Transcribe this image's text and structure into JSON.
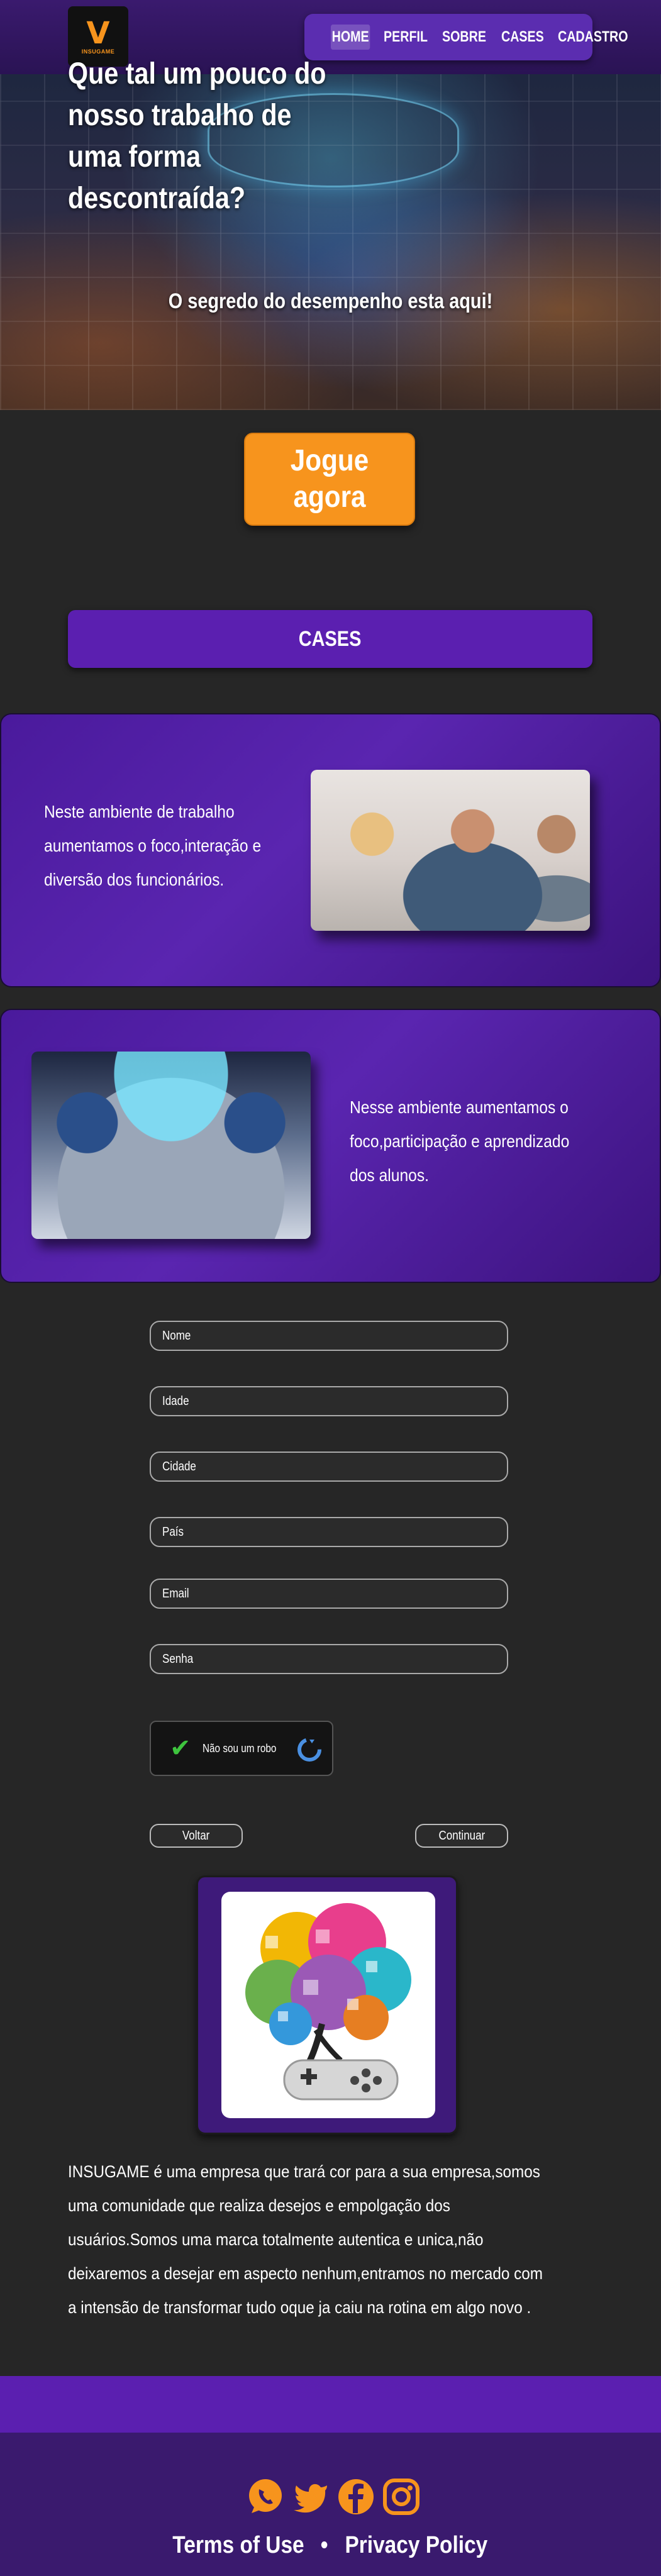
{
  "header": {
    "logo_text": "INSUGAME",
    "logo_mark": "V",
    "nav": [
      "HOME",
      "PERFIL",
      "SOBRE",
      "CASES",
      "CADASTRO"
    ]
  },
  "hero": {
    "title": "Que tal um pouco do nosso trabalho de uma forma descontraída?",
    "subtitle": "O segredo do desempenho esta aqui!"
  },
  "play": {
    "label": "Jogue agora"
  },
  "cases": {
    "heading": "CASES",
    "items": [
      {
        "text": "Neste ambiente de trabalho aumentamos o foco,interação e diversão dos funcionários."
      },
      {
        "text": "Nesse ambiente aumentamos o foco,participação e aprendizado dos alunos."
      }
    ]
  },
  "form": {
    "fields": [
      "Nome",
      "Idade",
      "Cidade",
      "País",
      "Email",
      "Senha"
    ],
    "captcha_label": "Não sou um robo",
    "back": "Voltar",
    "next": "Continuar"
  },
  "about": {
    "text": "INSUGAME  é uma empresa que trará cor para a sua empresa,somos uma comunidade que realiza desejos e empolgação dos usuários.Somos uma marca totalmente autentica e unica,não deixaremos a desejar em aspecto nenhum,entramos no mercado com a intensão de transformar tudo oque ja caiu na rotina em  algo novo ."
  },
  "footer": {
    "socials": [
      "whatsapp-icon",
      "twitter-icon",
      "facebook-icon",
      "instagram-icon"
    ],
    "terms": "Terms of Use",
    "separator": "•",
    "privacy": "Privacy Policy"
  },
  "colors": {
    "accent": "#f7941d",
    "purple": "#5b1fb0",
    "dark": "#262626"
  }
}
